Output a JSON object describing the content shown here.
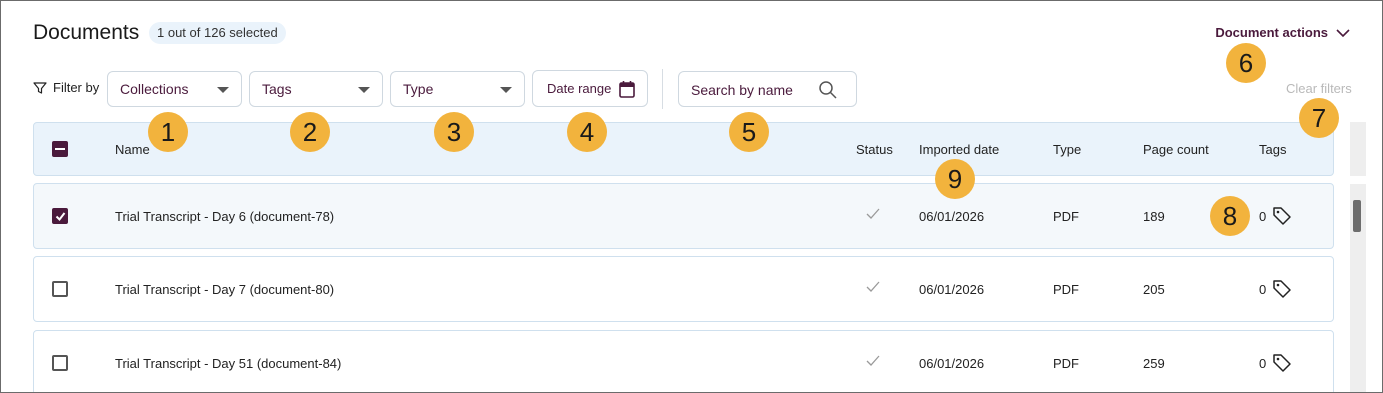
{
  "header": {
    "title": "Documents",
    "selection_badge": "1 out of 126 selected",
    "document_actions_label": "Document actions"
  },
  "filters": {
    "filter_by_label": "Filter by",
    "collections_placeholder": "Collections",
    "tags_placeholder": "Tags",
    "type_placeholder": "Type",
    "date_range_label": "Date range",
    "search_placeholder": "Search by name",
    "clear_filters_label": "Clear filters"
  },
  "table": {
    "columns": {
      "name": "Name",
      "status": "Status",
      "imported_date": "Imported date",
      "type": "Type",
      "page_count": "Page count",
      "tags": "Tags"
    },
    "rows": [
      {
        "name": "Trial Transcript - Day 6 (document-78)",
        "selected": true,
        "status_icon": "check-icon",
        "imported_date": "06/01/2026",
        "type": "PDF",
        "page_count": "189",
        "tags": "0"
      },
      {
        "name": "Trial Transcript - Day 7 (document-80)",
        "selected": false,
        "status_icon": "check-icon",
        "imported_date": "06/01/2026",
        "type": "PDF",
        "page_count": "205",
        "tags": "0"
      },
      {
        "name": "Trial Transcript - Day 51 (document-84)",
        "selected": false,
        "status_icon": "check-icon",
        "imported_date": "06/01/2026",
        "type": "PDF",
        "page_count": "259",
        "tags": "0"
      }
    ]
  },
  "callouts": [
    "1",
    "2",
    "3",
    "4",
    "5",
    "6",
    "7",
    "8",
    "9"
  ],
  "colors": {
    "accent": "#4a1a3c",
    "callout": "#f2b33d",
    "header_bg": "#eaf3fb"
  }
}
